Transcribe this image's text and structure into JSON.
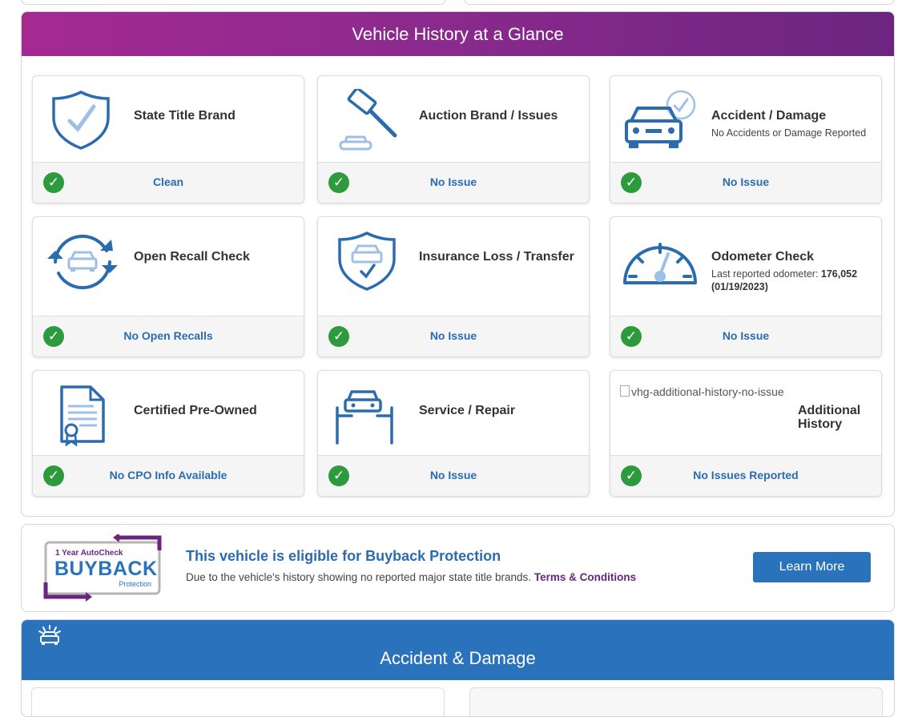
{
  "glance": {
    "title": "Vehicle History at a Glance",
    "cards": [
      {
        "title": "State Title Brand",
        "subtitle": "",
        "status": "Clean",
        "icon": "shield-check-icon"
      },
      {
        "title": "Auction Brand / Issues",
        "subtitle": "",
        "status": "No Issue",
        "icon": "gavel-icon"
      },
      {
        "title": "Accident / Damage",
        "subtitle": "No Accidents or Damage Reported",
        "status": "No Issue",
        "icon": "car-check-icon"
      },
      {
        "title": "Open Recall Check",
        "subtitle": "",
        "status": "No Open Recalls",
        "icon": "recall-cycle-icon"
      },
      {
        "title": "Insurance Loss / Transfer",
        "subtitle": "",
        "status": "No Issue",
        "icon": "shield-car-icon"
      },
      {
        "title": "Odometer Check",
        "subtitle_prefix": "Last reported odometer: ",
        "subtitle_value": "176,052 (01/19/2023)",
        "status": "No Issue",
        "icon": "odometer-icon"
      },
      {
        "title": "Certified Pre-Owned",
        "subtitle": "",
        "status": "No CPO Info Available",
        "icon": "certificate-icon"
      },
      {
        "title": "Service / Repair",
        "subtitle": "",
        "status": "No Issue",
        "icon": "car-lift-icon"
      },
      {
        "title": "Additional History",
        "subtitle": "",
        "status": "No Issues Reported",
        "icon": "broken-image-icon",
        "alt_text": "vhg-additional-history-no-issue"
      }
    ]
  },
  "buyback": {
    "logo_line1": "1 Year AutoCheck",
    "logo_line2": "BUYBACK",
    "logo_line3": "Protection",
    "title": "This vehicle is eligible for Buyback Protection",
    "description": "Due to the vehicle's history showing no reported major state title brands.",
    "terms_link": "Terms & Conditions",
    "button": "Learn More"
  },
  "accident_section": {
    "title": "Accident & Damage",
    "icon": "car-burst-icon"
  },
  "colors": {
    "header_gradient_start": "#a42a92",
    "header_gradient_end": "#6b2580",
    "status_blue": "#2b6cb0",
    "check_green": "#2e9a3e",
    "accent_blue": "#2b72bd"
  }
}
